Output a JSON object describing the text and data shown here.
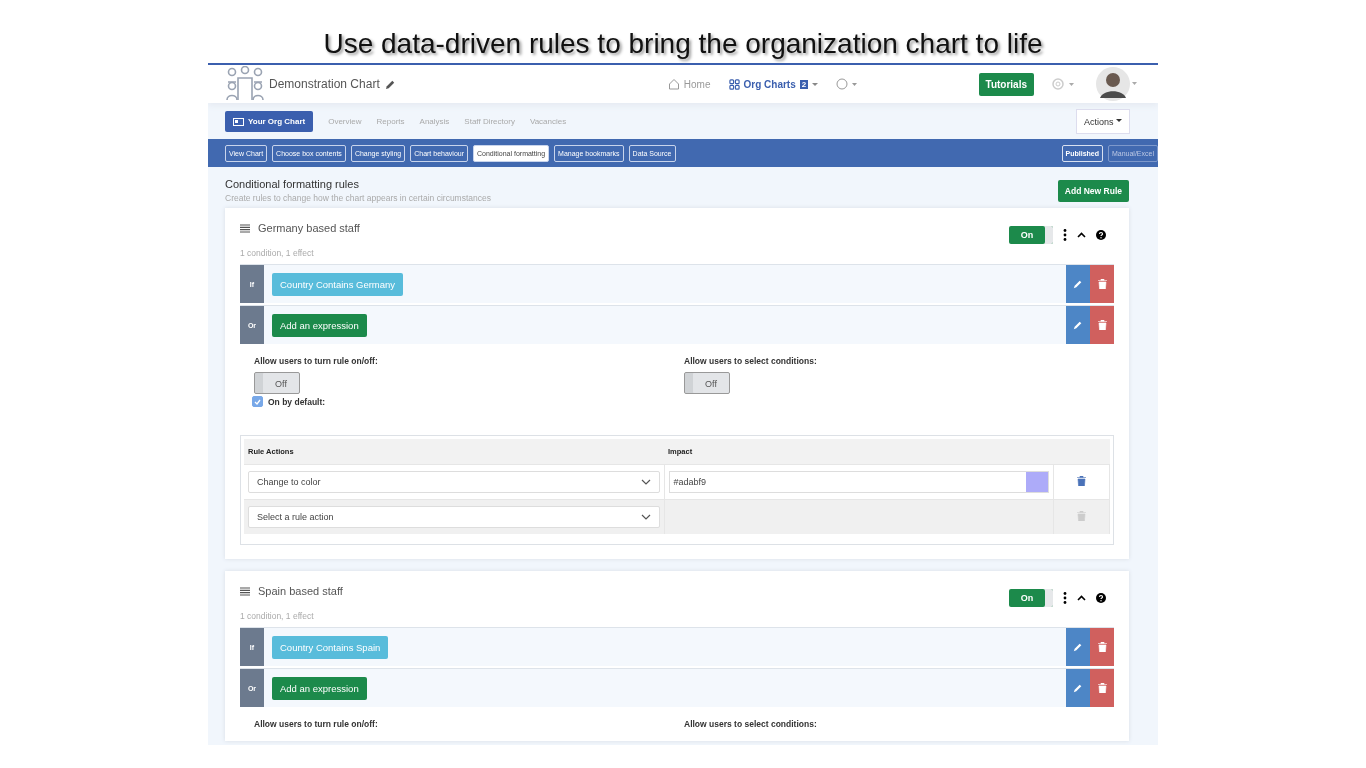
{
  "slide_title": "Use data-driven rules to bring the organization chart to life",
  "header": {
    "chart_name": "Demonstration Chart",
    "nav": [
      {
        "label": "Home",
        "kind": "home",
        "selected": false
      },
      {
        "label": "Org Charts",
        "kind": "grid",
        "selected": true,
        "badge": "2"
      }
    ],
    "tutorials": "Tutorials"
  },
  "tabs": [
    {
      "label": "Your Org Chart",
      "selected": true
    },
    {
      "label": "Overview",
      "selected": false
    },
    {
      "label": "Reports",
      "selected": false
    },
    {
      "label": "Analysis",
      "selected": false
    },
    {
      "label": "Staff Directory",
      "selected": false
    },
    {
      "label": "Vacancies",
      "selected": false
    }
  ],
  "actions_button": "Actions",
  "subtabs": [
    {
      "label": "View Chart",
      "selected": false
    },
    {
      "label": "Choose box contents",
      "selected": false
    },
    {
      "label": "Change styling",
      "selected": false
    },
    {
      "label": "Chart behaviour",
      "selected": false
    },
    {
      "label": "Conditional formatting",
      "selected": true
    },
    {
      "label": "Manage bookmarks",
      "selected": false
    },
    {
      "label": "Data Source",
      "selected": false
    }
  ],
  "mode_buttons": [
    {
      "label": "Published",
      "selected": true
    },
    {
      "label": "Manual/Excel",
      "selected": false
    }
  ],
  "section": {
    "title": "Conditional formatting rules",
    "subtitle": "Create rules to change how the chart appears in certain circumstances",
    "add_button": "Add New Rule"
  },
  "rules": [
    {
      "name": "Germany based staff",
      "summary": "1 condition, 1 effect",
      "on": true,
      "toggle_label": "On",
      "conditions": [
        {
          "kind": "condition",
          "prefix": "If",
          "text": "Country Contains Germany"
        },
        {
          "kind": "add",
          "prefix": "Or",
          "text": "Add an expression"
        }
      ],
      "allow_toggle": {
        "label": "Allow users to turn rule on/off:",
        "value": "Off",
        "on": false
      },
      "on_by_default": {
        "label": "On by default:",
        "checked": true
      },
      "allow_select": {
        "label": "Allow users to select conditions:",
        "value": "Off",
        "on": false
      },
      "actions_table": {
        "columns": [
          "Rule Actions",
          "Impact"
        ],
        "rows": [
          {
            "action": "Change to color",
            "impact": "#adabf9",
            "color": "#adabf9",
            "disabled": false
          },
          {
            "action": "Select a rule action",
            "disabled": true
          }
        ]
      }
    },
    {
      "name": "Spain based staff",
      "summary": "1 condition, 1 effect",
      "on": true,
      "toggle_label": "On",
      "conditions": [
        {
          "kind": "condition",
          "prefix": "If",
          "text": "Country Contains Spain"
        },
        {
          "kind": "add",
          "prefix": "Or",
          "text": "Add an expression"
        }
      ],
      "allow_toggle": {
        "label": "Allow users to turn rule on/off:"
      },
      "allow_select": {
        "label": "Allow users to select conditions:"
      }
    }
  ]
}
